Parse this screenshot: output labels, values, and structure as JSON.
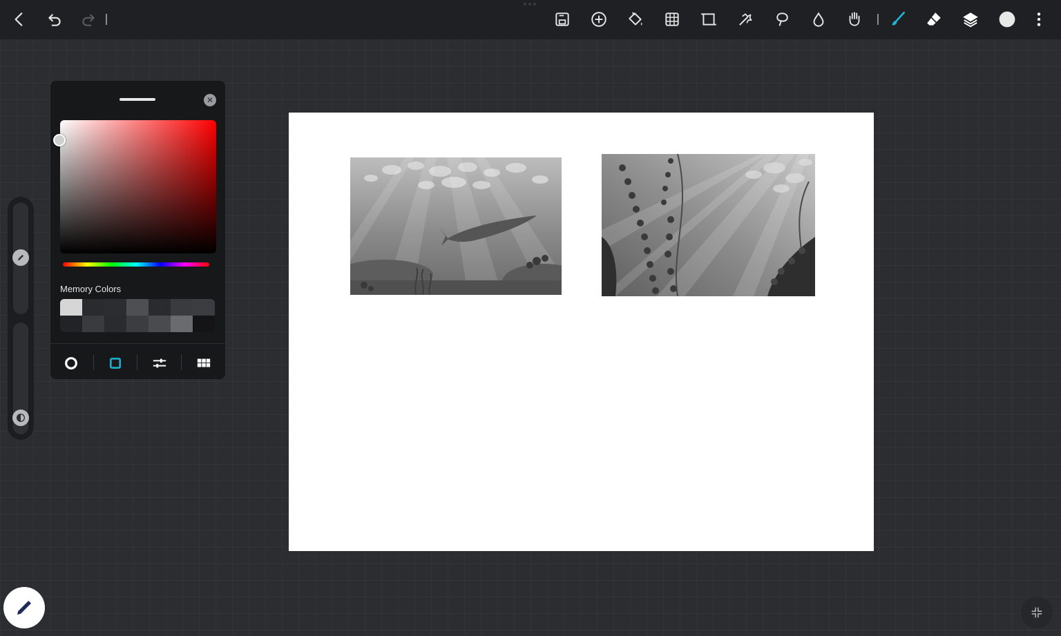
{
  "toolbar": {
    "left_icons": [
      "back-icon",
      "undo-icon",
      "redo-icon"
    ],
    "tool_icons": [
      "save-icon",
      "add-icon",
      "fill-bucket-icon",
      "grid-icon",
      "crop-icon",
      "magic-wand-icon",
      "lasso-icon",
      "blur-drop-icon",
      "smudge-icon"
    ],
    "active_tool": "brush-icon",
    "accent_color": "#1fb6d6",
    "current_color": "#e8e8e8"
  },
  "color_panel": {
    "hue_color": "#ff0000",
    "memory_label": "Memory Colors",
    "memory_colors": [
      "#d6d6d6",
      "#2a2b2e",
      "#2c2d30",
      "#4e4f52",
      "#2a2b2e",
      "#3a3b3e",
      "#3c3d40",
      "#222326",
      "#3a3b3e",
      "#2a2b2e",
      "#3c3d40",
      "#4a4b4e",
      "#6a6b6e",
      "#141416"
    ],
    "modes": [
      "disc-mode-icon",
      "square-mode-icon",
      "sliders-mode-icon",
      "palette-grid-icon"
    ],
    "active_mode": "square-mode-icon"
  },
  "side_sliders": {
    "size_icon": "pencil-icon",
    "opacity_icon": "opacity-icon"
  },
  "canvas": {
    "background": "#ffffff",
    "images": [
      "underwater-whale-image",
      "underwater-seaweed-image"
    ]
  }
}
